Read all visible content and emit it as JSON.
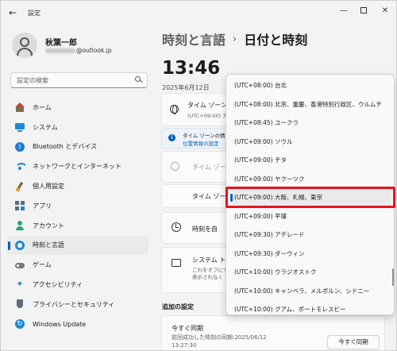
{
  "window": {
    "title": "設定",
    "back": "←",
    "minimize": "—",
    "close": "✕"
  },
  "profile": {
    "name": "秋葉一郎",
    "email_suffix": "@outlook.jp"
  },
  "search": {
    "placeholder": "設定の検索"
  },
  "nav": {
    "items": [
      {
        "label": "ホーム",
        "icon": "home-icon"
      },
      {
        "label": "システム",
        "icon": "system-icon"
      },
      {
        "label": "Bluetooth とデバイス",
        "icon": "bluetooth-icon"
      },
      {
        "label": "ネットワークとインターネット",
        "icon": "wifi-icon"
      },
      {
        "label": "個人用設定",
        "icon": "brush-icon"
      },
      {
        "label": "アプリ",
        "icon": "apps-icon"
      },
      {
        "label": "アカウント",
        "icon": "account-icon"
      },
      {
        "label": "時刻と言語",
        "icon": "time-language-icon",
        "active": true
      },
      {
        "label": "ゲーム",
        "icon": "game-icon"
      },
      {
        "label": "アクセシビリティ",
        "icon": "accessibility-icon"
      },
      {
        "label": "プライバシーとセキュリティ",
        "icon": "shield-icon"
      },
      {
        "label": "Windows Update",
        "icon": "update-icon"
      }
    ]
  },
  "main": {
    "breadcrumb_parent": "時刻と言語",
    "breadcrumb_sep": "›",
    "breadcrumb_current": "日付と時刻",
    "time": "13:46",
    "date": "2025年6月12日",
    "tz_label": "タイム ゾーン",
    "tz_sub": "(UTC+09:00) 大",
    "info_text": "タイム ゾーンの情報を",
    "info_link": "位置情報の設定",
    "auto_tz_label": "タイム ゾーンを",
    "tz_select_label": "タイム ゾーン",
    "auto_time_label": "時刻を自",
    "systray_label": "システム トレ",
    "systray_sub1": "これをオフにす",
    "systray_sub2": "表示されなく",
    "additional_heading": "追加の設定",
    "sync_title": "今すぐ同期",
    "sync_last": "前回成功した時刻の同期:2025/06/12",
    "sync_last_time": "13:27:30",
    "sync_button": "今すぐ同期"
  },
  "dropdown": {
    "options": [
      "(UTC+08:00) 台北",
      "(UTC+08:00) 北京、重慶、香港特別行政区、ウルムチ",
      "(UTC+08:45) ユークラ",
      "(UTC+09:00) ソウル",
      "(UTC+09:00) チタ",
      "(UTC+09:00) ヤクーツク",
      "(UTC+09:00) 大阪、札幌、東京",
      "(UTC+09:00) 平壌",
      "(UTC+09:30) アデレード",
      "(UTC+09:30) ダーウィン",
      "(UTC+10:00) ウラジオストク",
      "(UTC+10:00) キャンベラ、メルボルン、シドニー",
      "(UTC+10:00) グアム、ポートモレスビー"
    ],
    "selected_index": 6
  },
  "colors": {
    "accent": "#005fb8",
    "highlight": "#e8131b"
  }
}
